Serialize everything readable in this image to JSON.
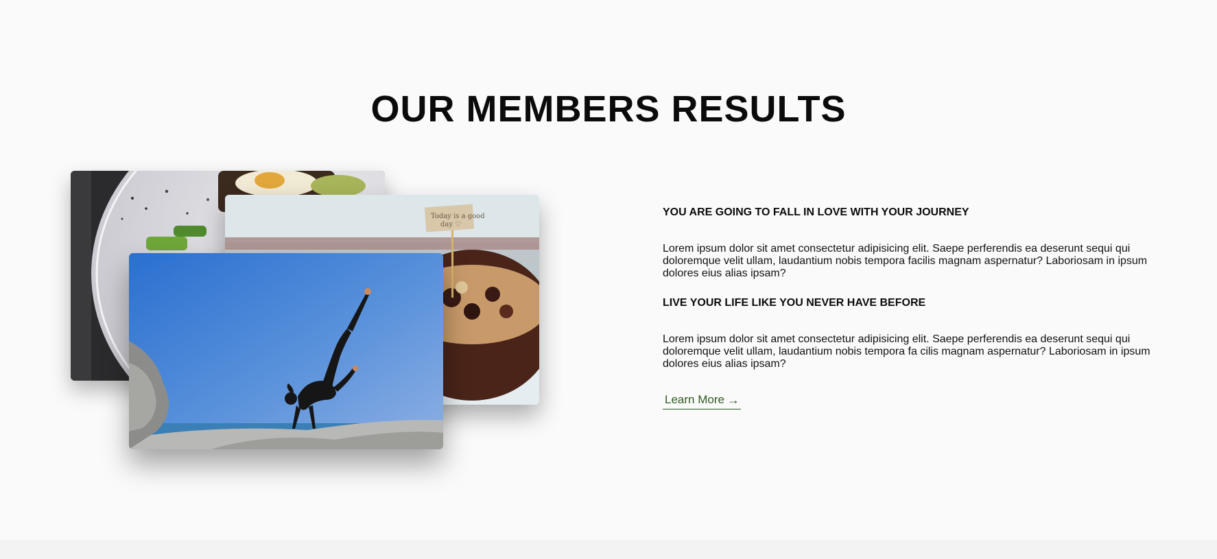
{
  "section": {
    "title": "OUR MEMBERS RESULTS"
  },
  "photos": [
    {
      "name": "healthy-food-plate",
      "subject": "plate with avocado toast and egg"
    },
    {
      "name": "smoothie-bowl",
      "subject": "coconut bowl with granola and a small sign"
    },
    {
      "name": "yoga-pose",
      "subject": "woman doing a yoga arm balance on rocks by the sea"
    }
  ],
  "content": {
    "heading_1": "YOU ARE GOING TO FALL IN LOVE WITH YOUR JOURNEY",
    "paragraph_1": "Lorem ipsum dolor sit amet consectetur adipisicing elit. Saepe perferendis ea deserunt sequi qui doloremque velit ullam, laudantium nobis tempora facilis magnam aspernatur? Laboriosam in ipsum dolores eius alias ipsam?",
    "heading_2": "LIVE YOUR LIFE LIKE YOU NEVER HAVE BEFORE",
    "paragraph_2": "Lorem ipsum dolor sit amet consectetur adipisicing elit. Saepe perferendis ea deserunt sequi qui doloremque velit ullam, laudantium nobis tempora fa cilis magnam aspernatur? Laboriosam in ipsum dolores eius alias ipsam?",
    "learn_more_label": "Learn More",
    "learn_more_arrow": "→"
  },
  "colors": {
    "background": "#fafafa",
    "text": "#111111",
    "link": "#2f5a21"
  }
}
